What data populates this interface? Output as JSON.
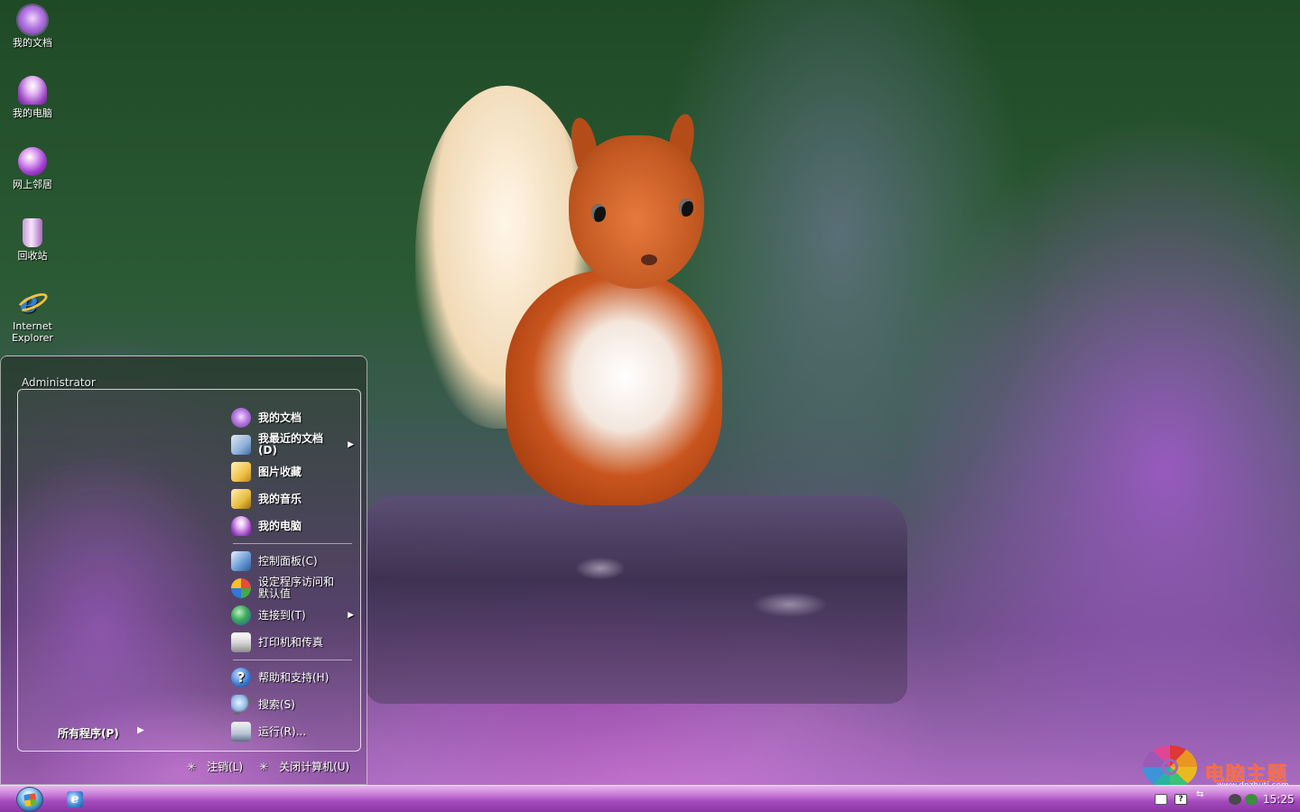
{
  "desktop": {
    "icons": [
      {
        "label": "我的文档",
        "icon": "my-documents-icon"
      },
      {
        "label": "我的电脑",
        "icon": "my-computer-icon"
      },
      {
        "label": "网上邻居",
        "icon": "network-places-icon"
      },
      {
        "label": "回收站",
        "icon": "recycle-bin-icon"
      },
      {
        "label": "Internet Explorer",
        "icon": "internet-explorer-icon"
      }
    ]
  },
  "start_menu": {
    "user": "Administrator",
    "all_programs": "所有程序(P)",
    "right_items": [
      {
        "label": "我的文档",
        "icon": "my-documents-icon",
        "bold": true
      },
      {
        "label": "我最近的文档(D)",
        "icon": "recent-documents-icon",
        "bold": true,
        "submenu": true
      },
      {
        "label": "图片收藏",
        "icon": "my-pictures-icon",
        "bold": true
      },
      {
        "label": "我的音乐",
        "icon": "my-music-icon",
        "bold": true
      },
      {
        "label": "我的电脑",
        "icon": "my-computer-icon",
        "bold": true
      },
      {
        "label": "控制面板(C)",
        "icon": "control-panel-icon"
      },
      {
        "label": "设定程序访问和默认值",
        "icon": "program-defaults-icon"
      },
      {
        "label": "连接到(T)",
        "icon": "connect-to-icon",
        "submenu": true
      },
      {
        "label": "打印机和传真",
        "icon": "printers-icon"
      },
      {
        "label": "帮助和支持(H)",
        "icon": "help-icon"
      },
      {
        "label": "搜索(S)",
        "icon": "search-icon"
      },
      {
        "label": "运行(R)...",
        "icon": "run-icon"
      }
    ],
    "logoff": "注销(L)",
    "shutdown": "关闭计算机(U)"
  },
  "taskbar": {
    "start_icon": "windows-start-orb-icon",
    "quick_launch": "internet-explorer-icon",
    "clock": "15:25"
  },
  "watermark": {
    "text": "电脑主题",
    "url": "www.dnzhuti.com"
  },
  "colors": {
    "taskbar": "#a349bd",
    "accent": "#c77ad6"
  }
}
